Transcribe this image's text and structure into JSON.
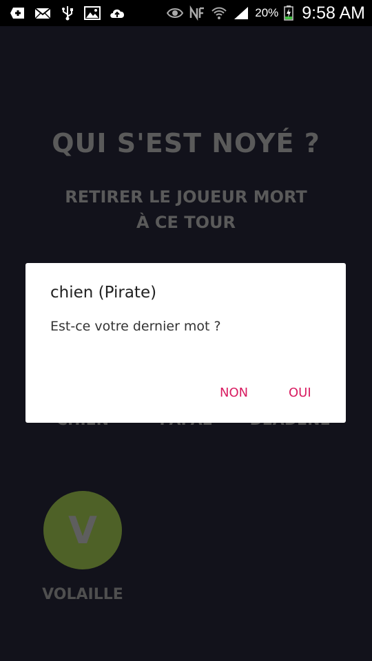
{
  "status_bar": {
    "icons_left": [
      "add-icon",
      "mail-icon",
      "usb-icon",
      "gallery-icon",
      "cloud-upload-icon"
    ],
    "icons_right": [
      "eye-icon",
      "nfc-icon",
      "wifi-icon",
      "signal-icon",
      "battery-charging-icon"
    ],
    "battery_percent": "20%",
    "time": "9:58 AM"
  },
  "screen": {
    "title": "QUI S'EST NOYÉ ?",
    "subtitle": "RETIRER LE JOUEUR MORT À CE TOUR"
  },
  "players": [
    {
      "name": "CHIEN"
    },
    {
      "name": "PAPAE"
    },
    {
      "name": "DEADENE"
    },
    {
      "name": "VOLAILLE",
      "initial": "V",
      "avatar_color": "#4e6127"
    }
  ],
  "dialog": {
    "title": "chien (Pirate)",
    "message": "Est-ce votre dernier mot ?",
    "negative_label": "NON",
    "positive_label": "OUI",
    "accent_color": "#d81b60"
  }
}
